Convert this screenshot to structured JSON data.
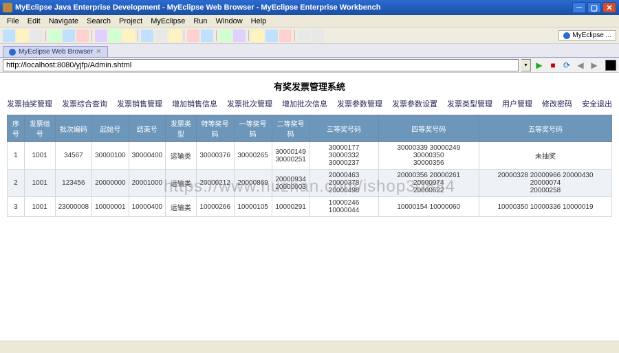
{
  "window": {
    "title": "MyEclipse Java Enterprise Development - MyEclipse Web Browser - MyEclipse Enterprise Workbench"
  },
  "menu": [
    "File",
    "Edit",
    "Navigate",
    "Search",
    "Project",
    "MyEclipse",
    "Run",
    "Window",
    "Help"
  ],
  "toolbar_label": "MyEclipse ...",
  "tab": {
    "label": "MyEclipse Web Browser"
  },
  "address": "http://localhost:8080/yjfp/Admin.shtml",
  "page_title": "有奖发票管理系统",
  "nav_items": [
    "发票抽奖管理",
    "发票综合查询",
    "发票销售管理",
    "增加销售信息",
    "发票批次管理",
    "增加批次信息",
    "发票参数管理",
    "发票参数设置",
    "发票类型管理",
    "用户管理",
    "修改密码",
    "安全退出"
  ],
  "columns": [
    "序号",
    "发票组号",
    "批次编码",
    "起始号",
    "结束号",
    "发票类型",
    "特等奖号码",
    "一等奖号码",
    "二等奖号码",
    "三等奖号码",
    "四等奖号码",
    "五等奖号码"
  ],
  "rows": [
    {
      "c": [
        "1",
        "1001",
        "34567",
        "30000100",
        "30000400",
        "运输类",
        "30000376",
        "30000265",
        "30000149\n30000251",
        "30000177 30000332\n30000237",
        "30000339 30000249 30000350\n30000356",
        "未抽奖"
      ]
    },
    {
      "c": [
        "2",
        "1001",
        "123456",
        "20000000",
        "20001000",
        "运输类",
        "20000212",
        "20000869",
        "20000934\n20000003",
        "20000463 20000378\n20000498",
        "20000356 20000261 20000974\n20000622",
        "20000328 20000966 20000430 20000074\n20000258"
      ]
    },
    {
      "c": [
        "3",
        "1001",
        "23000008",
        "10000001",
        "10000400",
        "运输类",
        "10000266",
        "10000105",
        "10000291",
        "10000246 10000044",
        "10000154 10000060",
        "10000350 10000336 10000019"
      ]
    }
  ],
  "watermark": "https://www.huzhan.com/ishop30884"
}
